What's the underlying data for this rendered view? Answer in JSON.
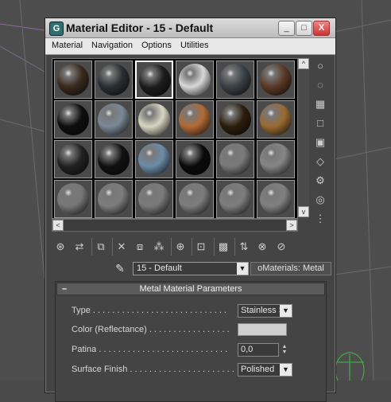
{
  "window": {
    "title": "Material Editor - 15 - Default",
    "minimize_label": "_",
    "maximize_label": "□",
    "close_label": "X"
  },
  "menu": [
    "Material",
    "Navigation",
    "Options",
    "Utilities"
  ],
  "samples": [
    [
      "#3a2a1e",
      "#2a2f33",
      "#1c1c1c",
      "#d8d8d8",
      "#3a4148",
      "#5a3a26"
    ],
    [
      "#0e0e0e",
      "#7a8896",
      "#d8d6c2",
      "#b06a36",
      "#2c1e0c",
      "#9a6a32"
    ],
    [
      "#222222",
      "#111111",
      "#6c8ca8",
      "#0b0b0b",
      "#7a7a7a",
      "#858585"
    ],
    [
      "#777777",
      "#7c7c7c",
      "#7a7a7a",
      "#7c7c7c",
      "#7d7d7d",
      "#808080"
    ]
  ],
  "active_sample": 2,
  "scroll": {
    "left": "<",
    "right": ">",
    "up": "^",
    "down": "v"
  },
  "name_row": {
    "eyedropper": "✎",
    "material_name": "15 - Default",
    "type_button": "oMaterials: Metal"
  },
  "rollout": {
    "collapse": "–",
    "title": "Metal Material Parameters",
    "params": [
      {
        "label": "Type . . . . . . . . . . . . . . . . . . . . . . . . . . . .",
        "value": "Stainless Steel",
        "kind": "dropdown"
      },
      {
        "label": "Color (Reflectance) . . . . . . . . . . . . . . . . .",
        "value": "",
        "kind": "color"
      },
      {
        "label": "Patina . . . . . . . . . . . . . . . . . . . . . . . . . . .",
        "value": "0,0",
        "kind": "spinner"
      },
      {
        "label": "Surface Finish . . . . . . . . . . . . . . . . . . . . . .",
        "value": "Polished",
        "kind": "dropdown"
      }
    ]
  },
  "colors": {
    "chrome": "#444444",
    "title_bg": "#d0d0d0",
    "viewport_lines": "#9b59b6"
  }
}
